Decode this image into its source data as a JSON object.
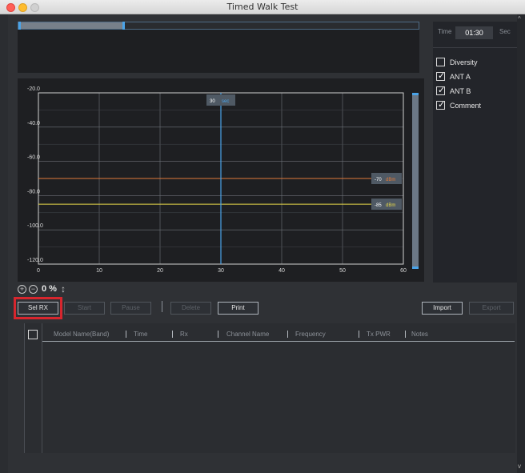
{
  "window": {
    "title": "Timed Walk Test"
  },
  "overview": {
    "progress": 0.26
  },
  "time_panel": {
    "label": "Time",
    "value": "01:30",
    "unit": "Sec"
  },
  "options": [
    {
      "label": "Diversity",
      "checked": false
    },
    {
      "label": "ANT A",
      "checked": true
    },
    {
      "label": "ANT B",
      "checked": true
    },
    {
      "label": "Comment",
      "checked": true
    }
  ],
  "chart_data": {
    "type": "line",
    "x_ticks": [
      "0",
      "10",
      "20",
      "30",
      "40",
      "50",
      "60"
    ],
    "y_ticks": [
      "-20.0",
      "-40.0",
      "-60.0",
      "-80.0",
      "-100.0",
      "-120.0"
    ],
    "xlim": [
      0,
      60
    ],
    "ylim": [
      -120,
      -20
    ],
    "grid": true,
    "cursor": {
      "x": 30,
      "value": "30",
      "unit": "sec"
    },
    "series": [
      {
        "value": -70,
        "tag": "-70",
        "unit": "dBm",
        "color": "#e07a3a"
      },
      {
        "value": -85,
        "tag": "-85",
        "unit": "dBm",
        "color": "#e6d84a"
      }
    ]
  },
  "zoom": {
    "value": "0 %"
  },
  "toolbar": {
    "sel_rx": "Sel RX",
    "start": "Start",
    "pause": "Pause",
    "delete": "Delete",
    "print": "Print",
    "import": "Import",
    "export": "Export"
  },
  "table": {
    "columns": [
      "Model Name(Band)",
      "Time",
      "Rx",
      "Channel Name",
      "Frequency",
      "Tx PWR",
      "Notes"
    ]
  },
  "colors": {
    "accent": "#4aa3e8",
    "highlight": "#d7262e",
    "grid": "#6e737a"
  }
}
